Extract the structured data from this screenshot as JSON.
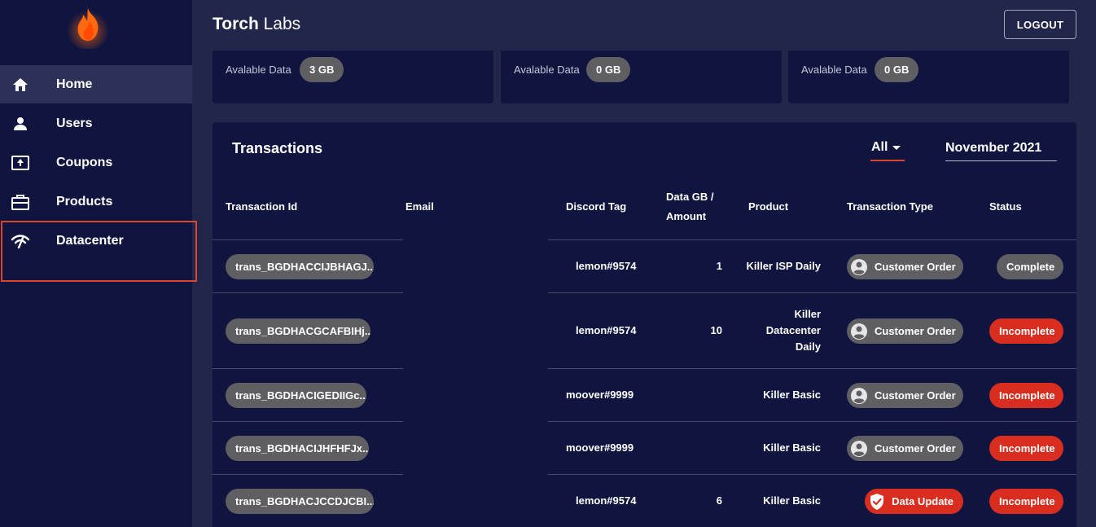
{
  "sidebar": {
    "items": [
      {
        "label": "Home",
        "icon": "home-icon"
      },
      {
        "label": "Users",
        "icon": "user-icon"
      },
      {
        "label": "Coupons",
        "icon": "coupon-icon"
      },
      {
        "label": "Products",
        "icon": "briefcase-icon"
      },
      {
        "label": "Datacenter",
        "icon": "wifi-icon"
      }
    ]
  },
  "header": {
    "brand_bold": "Torch",
    "brand_light": " Labs",
    "logout_label": "LOGOUT"
  },
  "cards": [
    {
      "label": "Avalable Data",
      "value": "3 GB"
    },
    {
      "label": "Avalable Data",
      "value": "0 GB"
    },
    {
      "label": "Avalable Data",
      "value": "0 GB"
    }
  ],
  "transactions": {
    "title": "Transactions",
    "filter_value": "All",
    "month_value": "November 2021",
    "columns": {
      "id": "Transaction Id",
      "email": "Email",
      "discord": "Discord Tag",
      "data_line1": "Data GB /",
      "data_line2": "Amount",
      "product": "Product",
      "type": "Transaction Type",
      "status": "Status"
    },
    "rows": [
      {
        "id": "trans_BGDHACCIJBHAGJ...",
        "discord": "lemon#9574",
        "amount": "1",
        "product": "Killer ISP Daily",
        "type": "Customer Order",
        "status": "Complete"
      },
      {
        "id": "trans_BGDHACGCAFBIHj...",
        "discord": "lemon#9574",
        "amount": "10",
        "product_lines": [
          "Killer",
          "Datacenter",
          "Daily"
        ],
        "type": "Customer Order",
        "status": "Incomplete"
      },
      {
        "id": "trans_BGDHACIGEDIIGc...",
        "discord": "moover#9999",
        "amount": "",
        "product": "Killer Basic",
        "type": "Customer Order",
        "status": "Incomplete"
      },
      {
        "id": "trans_BGDHACIJHFHFJx...",
        "discord": "moover#9999",
        "amount": "",
        "product": "Killer Basic",
        "type": "Customer Order",
        "status": "Incomplete"
      },
      {
        "id": "trans_BGDHACJCCDJCBI...",
        "discord": "lemon#9574",
        "amount": "6",
        "product": "Killer Basic",
        "type": "Data Update",
        "status": "Incomplete"
      }
    ]
  },
  "colors": {
    "sidebar_bg": "#101540",
    "page_bg": "#22264a",
    "accent_red": "#d92e1f",
    "pill_grey": "#5f5f63"
  }
}
